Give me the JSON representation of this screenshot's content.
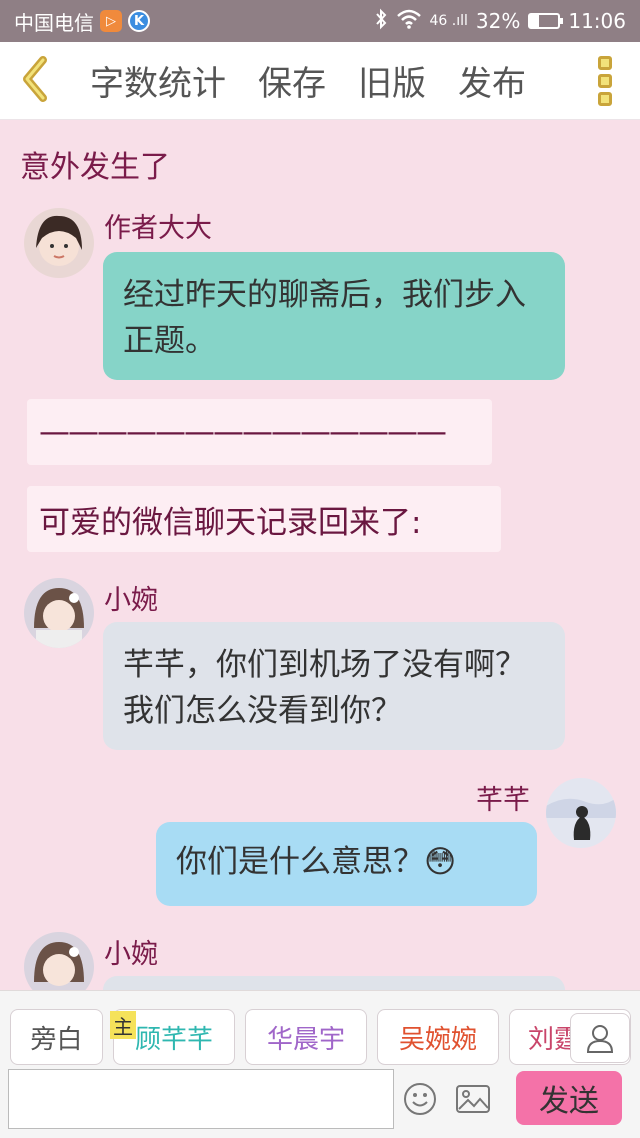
{
  "status_bar": {
    "carrier": "中国电信",
    "signal": "46 .ıll",
    "battery": "32%",
    "battery_level": 0.32,
    "time": "11:06"
  },
  "toolbar": {
    "word_count": "字数统计",
    "save": "保存",
    "old_version": "旧版",
    "publish": "发布"
  },
  "chapter_title": "意外发生了",
  "messages": [
    {
      "speaker": "作者大大",
      "text": "经过昨天的聊斋后，我们步入正题。"
    },
    {
      "narration": "——————————————"
    },
    {
      "narration": "可爱的微信聊天记录回来了:"
    },
    {
      "speaker": "小婉",
      "text": "芊芊，你们到机场了没有啊？我们怎么没看到你？"
    },
    {
      "speaker": "芊芊",
      "text": "你们是什么意思？😳"
    },
    {
      "speaker": "小婉"
    }
  ],
  "characters": [
    {
      "name": "旁白",
      "color": "#555555"
    },
    {
      "name": "顾芊芊",
      "color": "#2fb7b0",
      "tag": "主"
    },
    {
      "name": "华晨宇",
      "color": "#a066c9"
    },
    {
      "name": "吴婉婉",
      "color": "#e0512f"
    },
    {
      "name": "刘霆",
      "color": "#c9456a"
    }
  ],
  "composer": {
    "placeholder": "",
    "send": "发送",
    "send_color": "#f472a8"
  },
  "icons": [
    "back-arrow-icon",
    "menu-icon",
    "user-icon",
    "emoji-icon",
    "image-icon"
  ]
}
